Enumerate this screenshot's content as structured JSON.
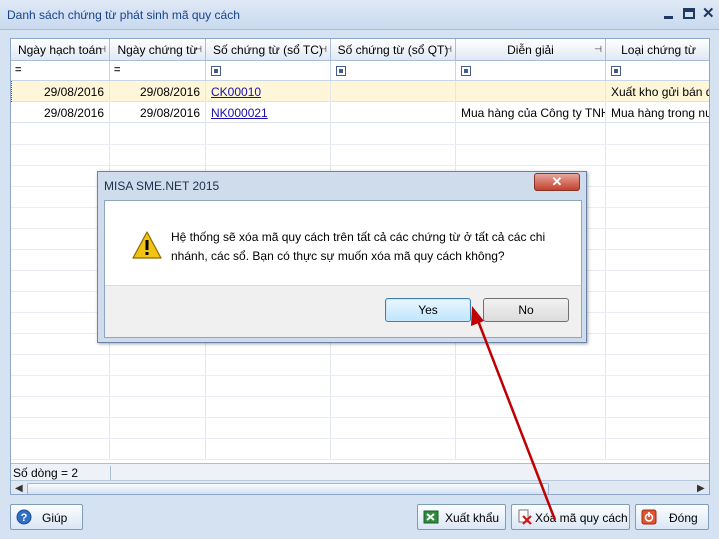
{
  "window": {
    "title": "Danh sách chứng từ phát sinh mã quy cách"
  },
  "grid": {
    "columns": [
      {
        "label": "Ngày hạch toán"
      },
      {
        "label": "Ngày chứng từ"
      },
      {
        "label": "Số chứng từ (sổ TC)"
      },
      {
        "label": "Số chứng từ (sổ QT)"
      },
      {
        "label": "Diễn giải"
      },
      {
        "label": "Loại chứng từ"
      }
    ],
    "filter": {
      "eq": "="
    },
    "rows": [
      {
        "ngay_hach_toan": "29/08/2016",
        "ngay_chung_tu": "29/08/2016",
        "so_tc": "CK00010",
        "so_qt": "",
        "dien_giai": "",
        "loai": "Xuất kho gửi bán đại lý"
      },
      {
        "ngay_hach_toan": "29/08/2016",
        "ngay_chung_tu": "29/08/2016",
        "so_tc": "NK000021",
        "so_qt": "",
        "dien_giai": "Mua hàng của Công ty TNH",
        "loai": "Mua hàng trong nước"
      }
    ],
    "row_count": "Số dòng = 2"
  },
  "buttons": {
    "help": "Giúp",
    "export": "Xuất khẩu",
    "delete_spec": "Xóa mã quy cách",
    "close": "Đóng"
  },
  "dialog": {
    "title": "MISA SME.NET 2015",
    "message": "Hệ thống sẽ xóa mã quy cách trên tất cả các chứng từ ở tất cả các chi nhánh, các sổ. Bạn có thực sự muốn xóa mã quy cách không?",
    "yes": "Yes",
    "no": "No"
  },
  "colors": {
    "accent": "#15428b",
    "selected_row": "#fdf6d8",
    "link": "#1a0dab",
    "annotation_arrow": "#c00000"
  },
  "icons": [
    "minimize-icon",
    "maximize-icon",
    "close-icon",
    "pin-icon",
    "filter-icon",
    "help-icon",
    "excel-icon",
    "delete-icon",
    "exit-icon",
    "warning-icon"
  ]
}
